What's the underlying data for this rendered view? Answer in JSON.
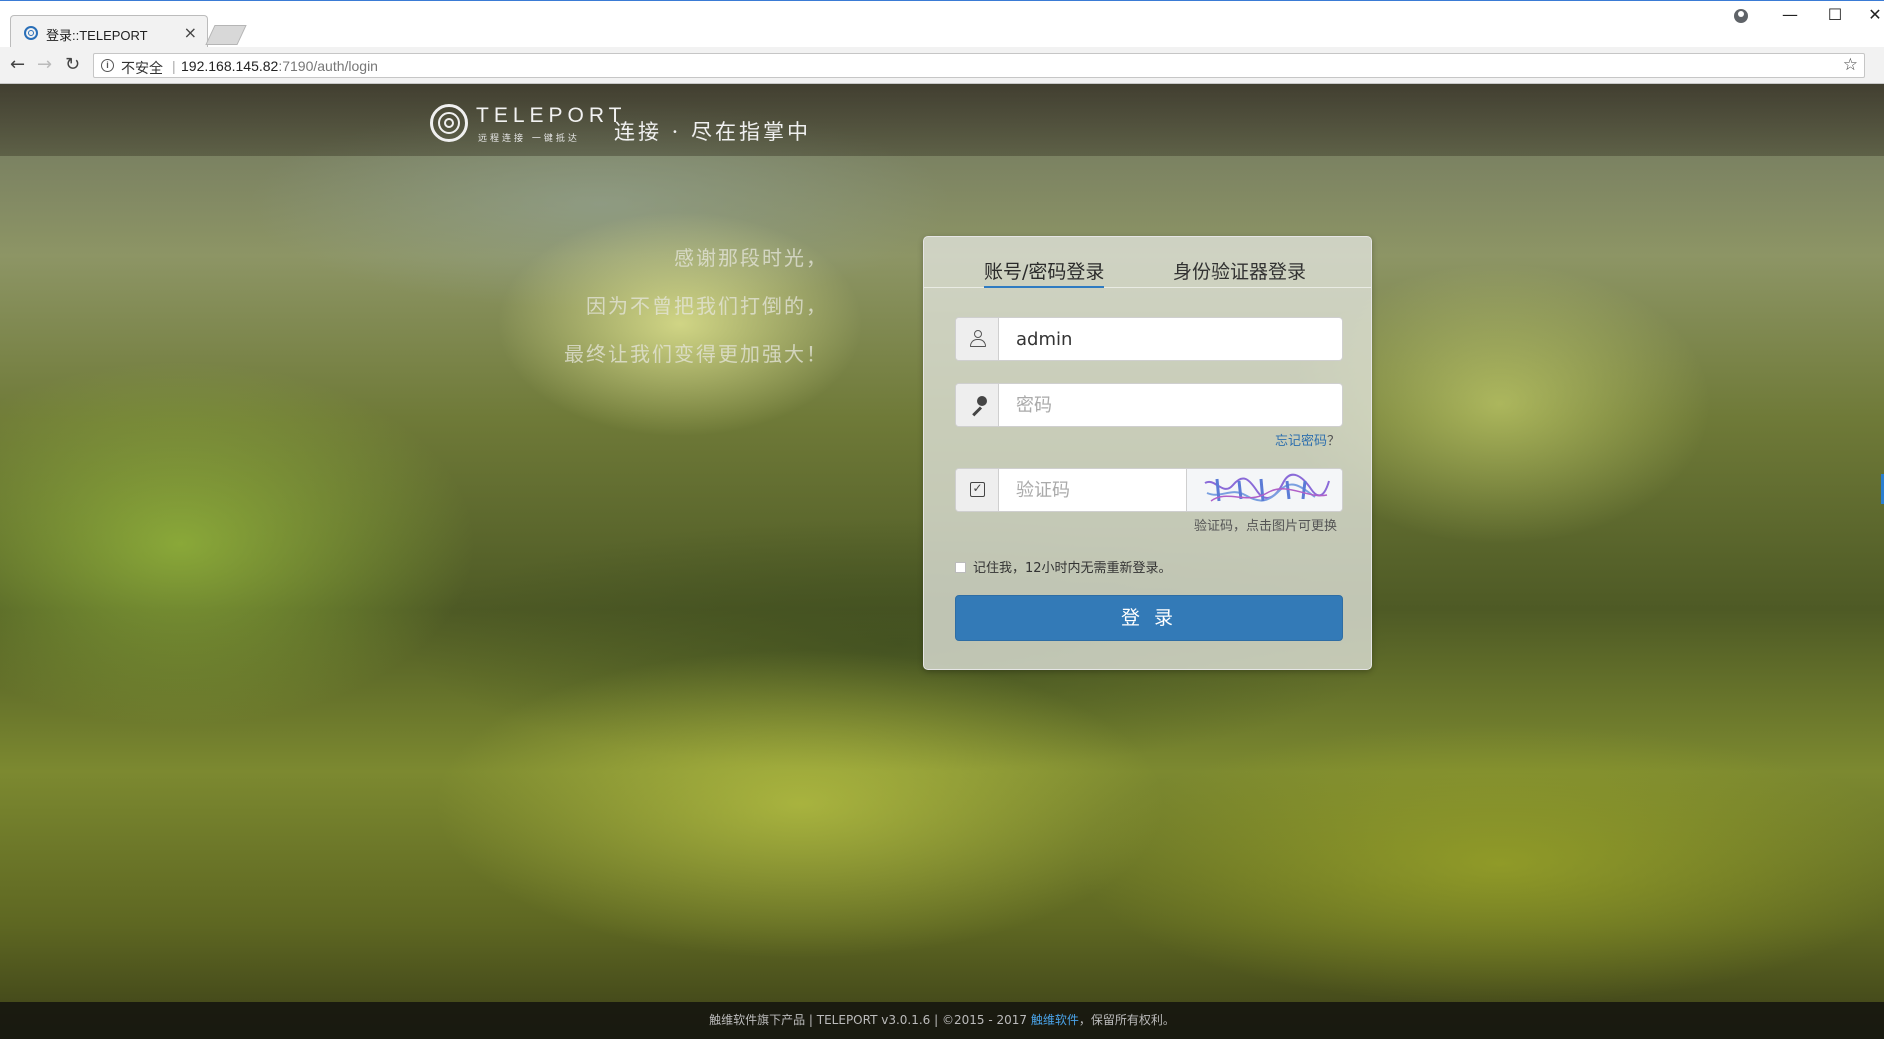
{
  "browser": {
    "tab_title": "登录::TELEPORT",
    "close_glyph": "×",
    "security_label": "不安全",
    "url_host": "192.168.145.82",
    "url_rest": ":7190/auth/login",
    "window_controls": {
      "minimize": "—",
      "maximize": "☐",
      "close": "✕"
    }
  },
  "header": {
    "logo_name": "TELEPORT",
    "logo_sub": "远程连接 一键抵达",
    "slogan": "连接 · 尽在指掌中"
  },
  "poem": {
    "line1": "感谢那段时光，",
    "line2": "因为不曾把我们打倒的，",
    "line3": "最终让我们变得更加强大！"
  },
  "login": {
    "tabs": [
      {
        "label": "账号/密码登录",
        "active": true
      },
      {
        "label": "身份验证器登录",
        "active": false
      }
    ],
    "username_value": "admin",
    "password_placeholder": "密码",
    "forgot_label": "忘记密码",
    "forgot_q": "？",
    "captcha_placeholder": "验证码",
    "captcha_hint": "验证码，点击图片可更换",
    "remember_label": "记住我，12小时内无需重新登录。",
    "submit_label": "登 录"
  },
  "footer": {
    "prefix": "触维软件旗下产品 | TELEPORT v3.0.1.6 | ©2015 - 2017 ",
    "link": "触维软件",
    "suffix": "，保留所有权利。"
  },
  "colors": {
    "accent": "#337ab7",
    "link": "#2e6fae",
    "footer_link": "#4aa3e8"
  }
}
